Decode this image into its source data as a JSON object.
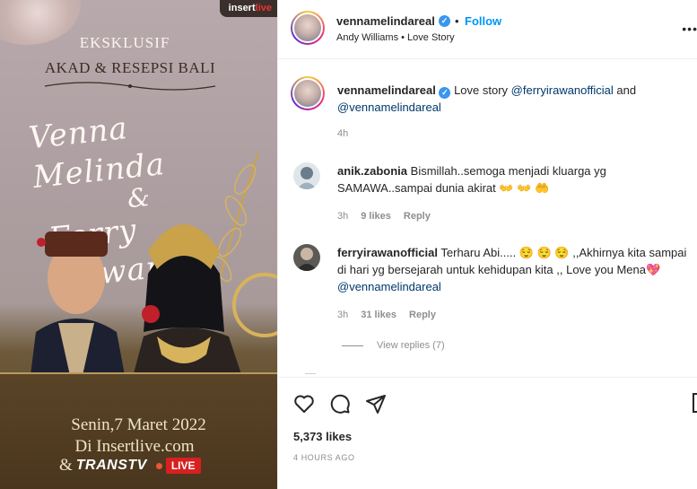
{
  "poster": {
    "brand": "insert",
    "brand_accent": "live",
    "heading1": "EKSKLUSIF",
    "heading2": "AKAD & RESEPSI BALI",
    "name1": "Venna Melinda",
    "amp": "&",
    "name2": "Ferry Irawan",
    "date": "Senin,7 Maret 2022",
    "site": "Di Insertlive.com",
    "tv_amp": "&",
    "tv_name": "TRANSTV",
    "live_badge": "LIVE"
  },
  "header": {
    "username": "vennamelindareal",
    "verified": "✓",
    "bullet": "•",
    "follow_label": "Follow",
    "audio": "Andy Williams • Love Story",
    "more": "•••"
  },
  "caption": {
    "username": "vennamelindareal",
    "text_before": "Love story ",
    "mention1": "@ferryirawanofficial",
    "text_mid": " and",
    "mention2": "@vennamelindareal",
    "time": "4h"
  },
  "comments": [
    {
      "username": "anik.zabonia",
      "text": "Bismillah..semoga menjadi kluarga yg SAMAWA..sampai dunia akirat 👐 👐 🤲",
      "time": "3h",
      "likes": "9 likes",
      "reply": "Reply"
    },
    {
      "username": "ferryirawanofficial",
      "text": "Terharu Abi..... 😌 😌 😌 ,,Akhirnya kita sampai di hari yg bersejarah untuk kehidupan kita ,, Love you Mena💖 ",
      "mention": "@vennamelindareal",
      "time": "3h",
      "likes": "31 likes",
      "reply": "Reply"
    }
  ],
  "view_replies": "View replies (7)",
  "footer": {
    "likes": "5,373 likes",
    "time_ago": "4 HOURS AGO"
  },
  "icons": {
    "like": "heart-icon",
    "comment": "comment-icon",
    "share": "share-icon",
    "save": "bookmark-icon"
  },
  "colors": {
    "follow": "#0095f6",
    "mention": "#00376b",
    "verified": "#3897f0",
    "muted": "#8e8e8e",
    "live": "#d82020"
  }
}
